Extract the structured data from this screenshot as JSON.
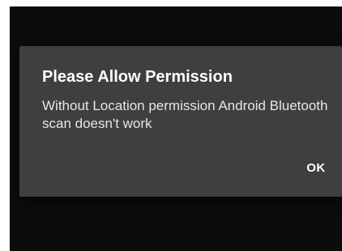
{
  "dialog": {
    "title": "Please Allow Permission",
    "message": "Without Location permission Android Bluetooth scan doesn't work",
    "ok_label": "OK"
  },
  "colors": {
    "screen_background": "#0b0c0c",
    "dialog_background": "#3e3f3f",
    "text_primary": "#ffffff"
  }
}
